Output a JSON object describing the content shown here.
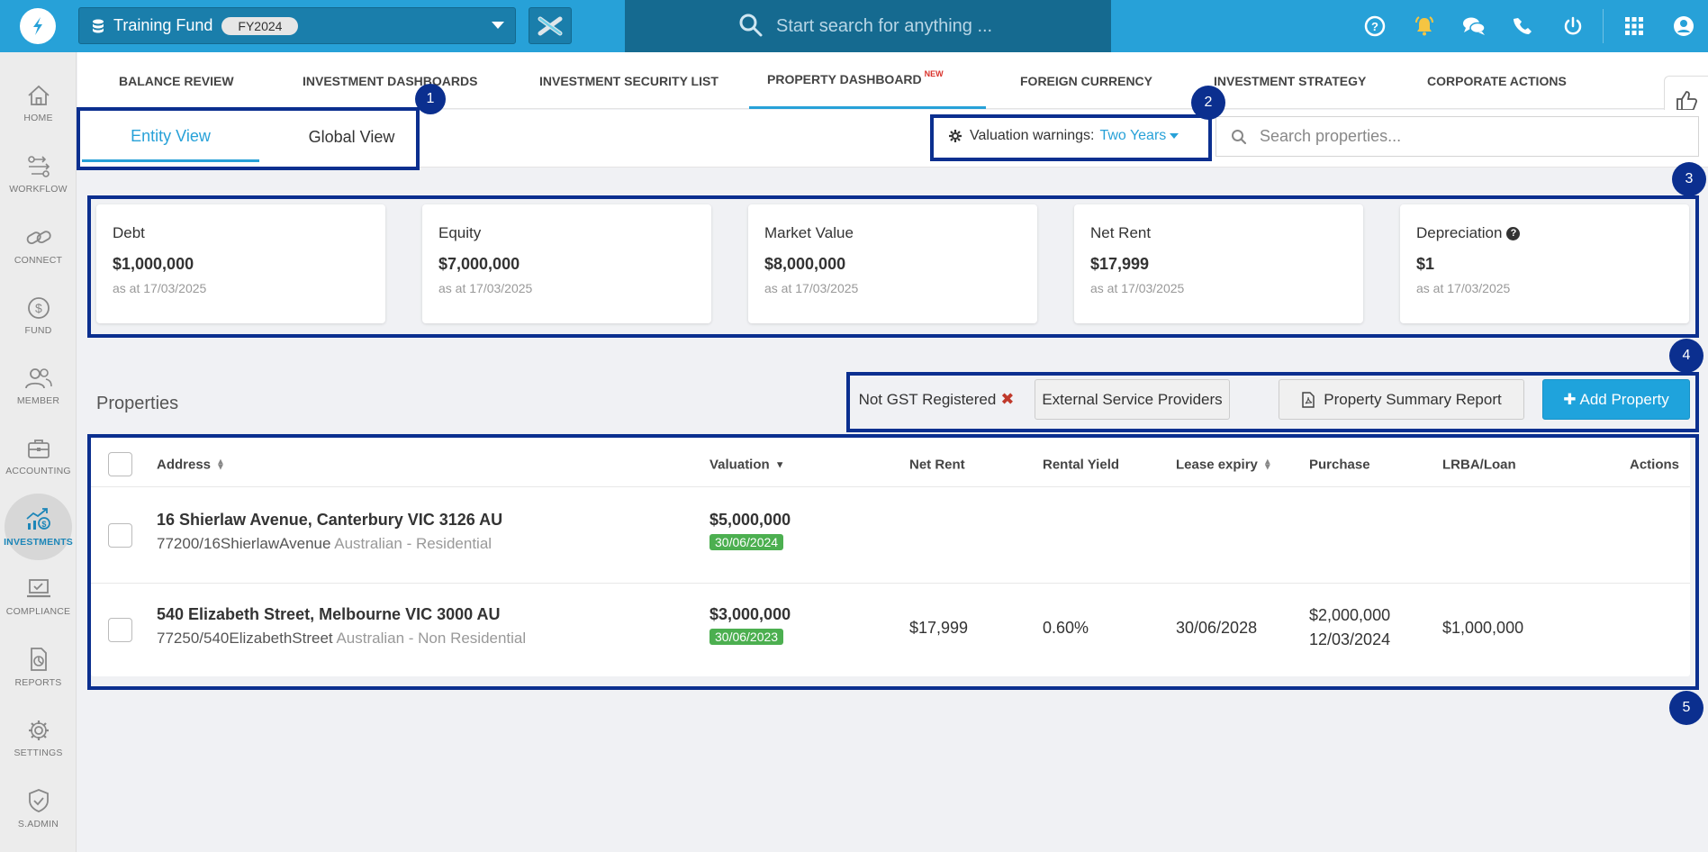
{
  "topbar": {
    "fund_name": "Training Fund",
    "fund_year": "FY2024",
    "search_placeholder": "Start search for anything ...",
    "icons": [
      "help-icon",
      "bell-icon",
      "chat-icon",
      "phone-icon",
      "power-icon",
      "apps-grid-icon",
      "user-icon"
    ]
  },
  "sidebar": {
    "items": [
      {
        "label": "HOME",
        "icon": "home-icon"
      },
      {
        "label": "WORKFLOW",
        "icon": "workflow-icon"
      },
      {
        "label": "CONNECT",
        "icon": "link-icon"
      },
      {
        "label": "FUND",
        "icon": "dollar-icon"
      },
      {
        "label": "MEMBER",
        "icon": "members-icon"
      },
      {
        "label": "ACCOUNTING",
        "icon": "briefcase-icon"
      },
      {
        "label": "INVESTMENTS",
        "icon": "investments-icon"
      },
      {
        "label": "COMPLIANCE",
        "icon": "laptop-check-icon"
      },
      {
        "label": "REPORTS",
        "icon": "report-icon"
      },
      {
        "label": "SETTINGS",
        "icon": "gear-icon"
      },
      {
        "label": "S.ADMIN",
        "icon": "shield-check-icon"
      }
    ]
  },
  "nav_tabs": {
    "items": [
      {
        "label": "BALANCE REVIEW"
      },
      {
        "label": "INVESTMENT DASHBOARDS"
      },
      {
        "label": "INVESTMENT SECURITY LIST"
      },
      {
        "label": "PROPERTY DASHBOARD",
        "badge": "NEW"
      },
      {
        "label": "FOREIGN CURRENCY"
      },
      {
        "label": "INVESTMENT STRATEGY"
      },
      {
        "label": "CORPORATE ACTIONS"
      }
    ]
  },
  "view_tabs": {
    "entity": "Entity View",
    "global": "Global View"
  },
  "valuation": {
    "label": "Valuation warnings:",
    "value": "Two Years"
  },
  "property_search": {
    "placeholder": "Search properties..."
  },
  "summary_cards": [
    {
      "title": "Debt",
      "value": "$1,000,000",
      "sub": "as at 17/03/2025"
    },
    {
      "title": "Equity",
      "value": "$7,000,000",
      "sub": "as at 17/03/2025"
    },
    {
      "title": "Market Value",
      "value": "$8,000,000",
      "sub": "as at 17/03/2025"
    },
    {
      "title": "Net Rent",
      "value": "$17,999",
      "sub": "as at 17/03/2025"
    },
    {
      "title": "Depreciation",
      "value": "$1",
      "sub": "as at 17/03/2025",
      "help": "?"
    }
  ],
  "properties": {
    "title": "Properties",
    "gst_filter": "Not GST Registered",
    "btn_external": "External Service Providers",
    "btn_report": "Property Summary Report",
    "btn_add": "Add Property",
    "columns": {
      "address": "Address",
      "valuation": "Valuation",
      "net_rent": "Net Rent",
      "rental_yield": "Rental Yield",
      "lease_expiry": "Lease expiry",
      "purchase": "Purchase",
      "lrba": "LRBA/Loan",
      "actions": "Actions"
    },
    "rows": [
      {
        "address": "16 Shierlaw Avenue, Canterbury VIC 3126 AU",
        "code": "77200/16ShierlawAvenue",
        "type": "Australian - Residential",
        "valuation": "$5,000,000",
        "valuation_date": "30/06/2024",
        "net_rent": "",
        "rental_yield": "",
        "lease_expiry": "",
        "purchase_amount": "",
        "purchase_date": "",
        "lrba": ""
      },
      {
        "address": "540 Elizabeth Street, Melbourne VIC 3000 AU",
        "code": "77250/540ElizabethStreet",
        "type": "Australian - Non Residential",
        "valuation": "$3,000,000",
        "valuation_date": "30/06/2023",
        "net_rent": "$17,999",
        "rental_yield": "0.60%",
        "lease_expiry": "30/06/2028",
        "purchase_amount": "$2,000,000",
        "purchase_date": "12/03/2024",
        "lrba": "$1,000,000"
      }
    ]
  },
  "annotations": [
    "1",
    "2",
    "3",
    "4",
    "5"
  ],
  "colors": {
    "brand": "#27a1d8",
    "annotation": "#0b2f8f",
    "badge_green": "#4caf50"
  }
}
